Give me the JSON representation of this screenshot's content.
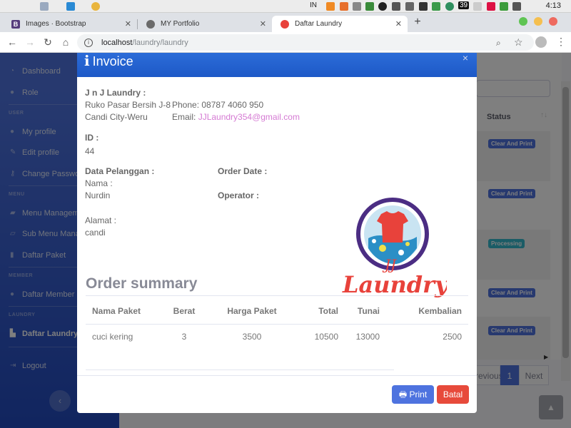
{
  "menubar": {
    "input_source": "IN",
    "battery_badge": "39",
    "clock": "4:13"
  },
  "tabs": [
    {
      "title": "Images · Bootstrap",
      "favicon": "B"
    },
    {
      "title": "MY Portfolio",
      "favicon": "globe-icon"
    },
    {
      "title": "Daftar Laundry",
      "favicon": "laundry-icon"
    }
  ],
  "address": {
    "host": "localhost",
    "path": "/laundry/laundry"
  },
  "sidebar": {
    "items": [
      {
        "label": "Dashboard"
      },
      {
        "label": "Role"
      },
      {
        "heading": "USER"
      },
      {
        "label": "My profile"
      },
      {
        "label": "Edit profile"
      },
      {
        "label": "Change Password"
      },
      {
        "heading": "MENU"
      },
      {
        "label": "Menu Management"
      },
      {
        "label": "Sub Menu Management"
      },
      {
        "label": "Daftar Paket"
      },
      {
        "heading": "MEMBER"
      },
      {
        "label": "Daftar Member"
      },
      {
        "heading": "LAUNDRY"
      },
      {
        "label": "Daftar Laundry"
      },
      {
        "label": "Logout"
      }
    ],
    "toggle": "‹"
  },
  "background": {
    "status_header": "Status",
    "sort_icon": "↑↓",
    "badges": [
      "Clear And Print",
      "Clear And Print",
      "Processing",
      "Clear And Print",
      "Clear And Print"
    ],
    "pagination": {
      "previous": "Previous",
      "current": "1",
      "next": "Next"
    }
  },
  "modal": {
    "title": "Invoice",
    "close": "×",
    "company": {
      "name": "J n J Laundry :",
      "address_line1": "Ruko Pasar Bersih J-8",
      "address_line2": "Candi City-Weru",
      "phone": "Phone: 08787 4060 950",
      "email_label": "Email: ",
      "email": "JJLaundry354@gmail.com"
    },
    "id_label": "ID :",
    "id_value": "44",
    "customer_label": "Data Pelanggan :",
    "name_label": "Nama :",
    "name_value": "Nurdin",
    "address_label": "Alamat :",
    "address_value": "candi",
    "order_date_label": "Order Date :",
    "operator_label": "Operator :",
    "logo_text": "Laundry",
    "logo_initials": "JJ",
    "summary_title": "Order summary",
    "table": {
      "headers": [
        "Nama Paket",
        "Berat",
        "Harga Paket",
        "Total",
        "Tunai",
        "Kembalian"
      ],
      "rows": [
        [
          "cuci kering",
          "3",
          "3500",
          "10500",
          "13000",
          "2500"
        ]
      ]
    },
    "buttons": {
      "print": "Print",
      "cancel": "Batal"
    }
  },
  "colors": {
    "primary": "#4e73df",
    "danger": "#e74a3b",
    "info": "#36b9cc",
    "modal_header": "#2c6cd8",
    "email_link": "#d57ad3",
    "logo_red": "#e8423b",
    "logo_purple": "#4b2d83"
  }
}
